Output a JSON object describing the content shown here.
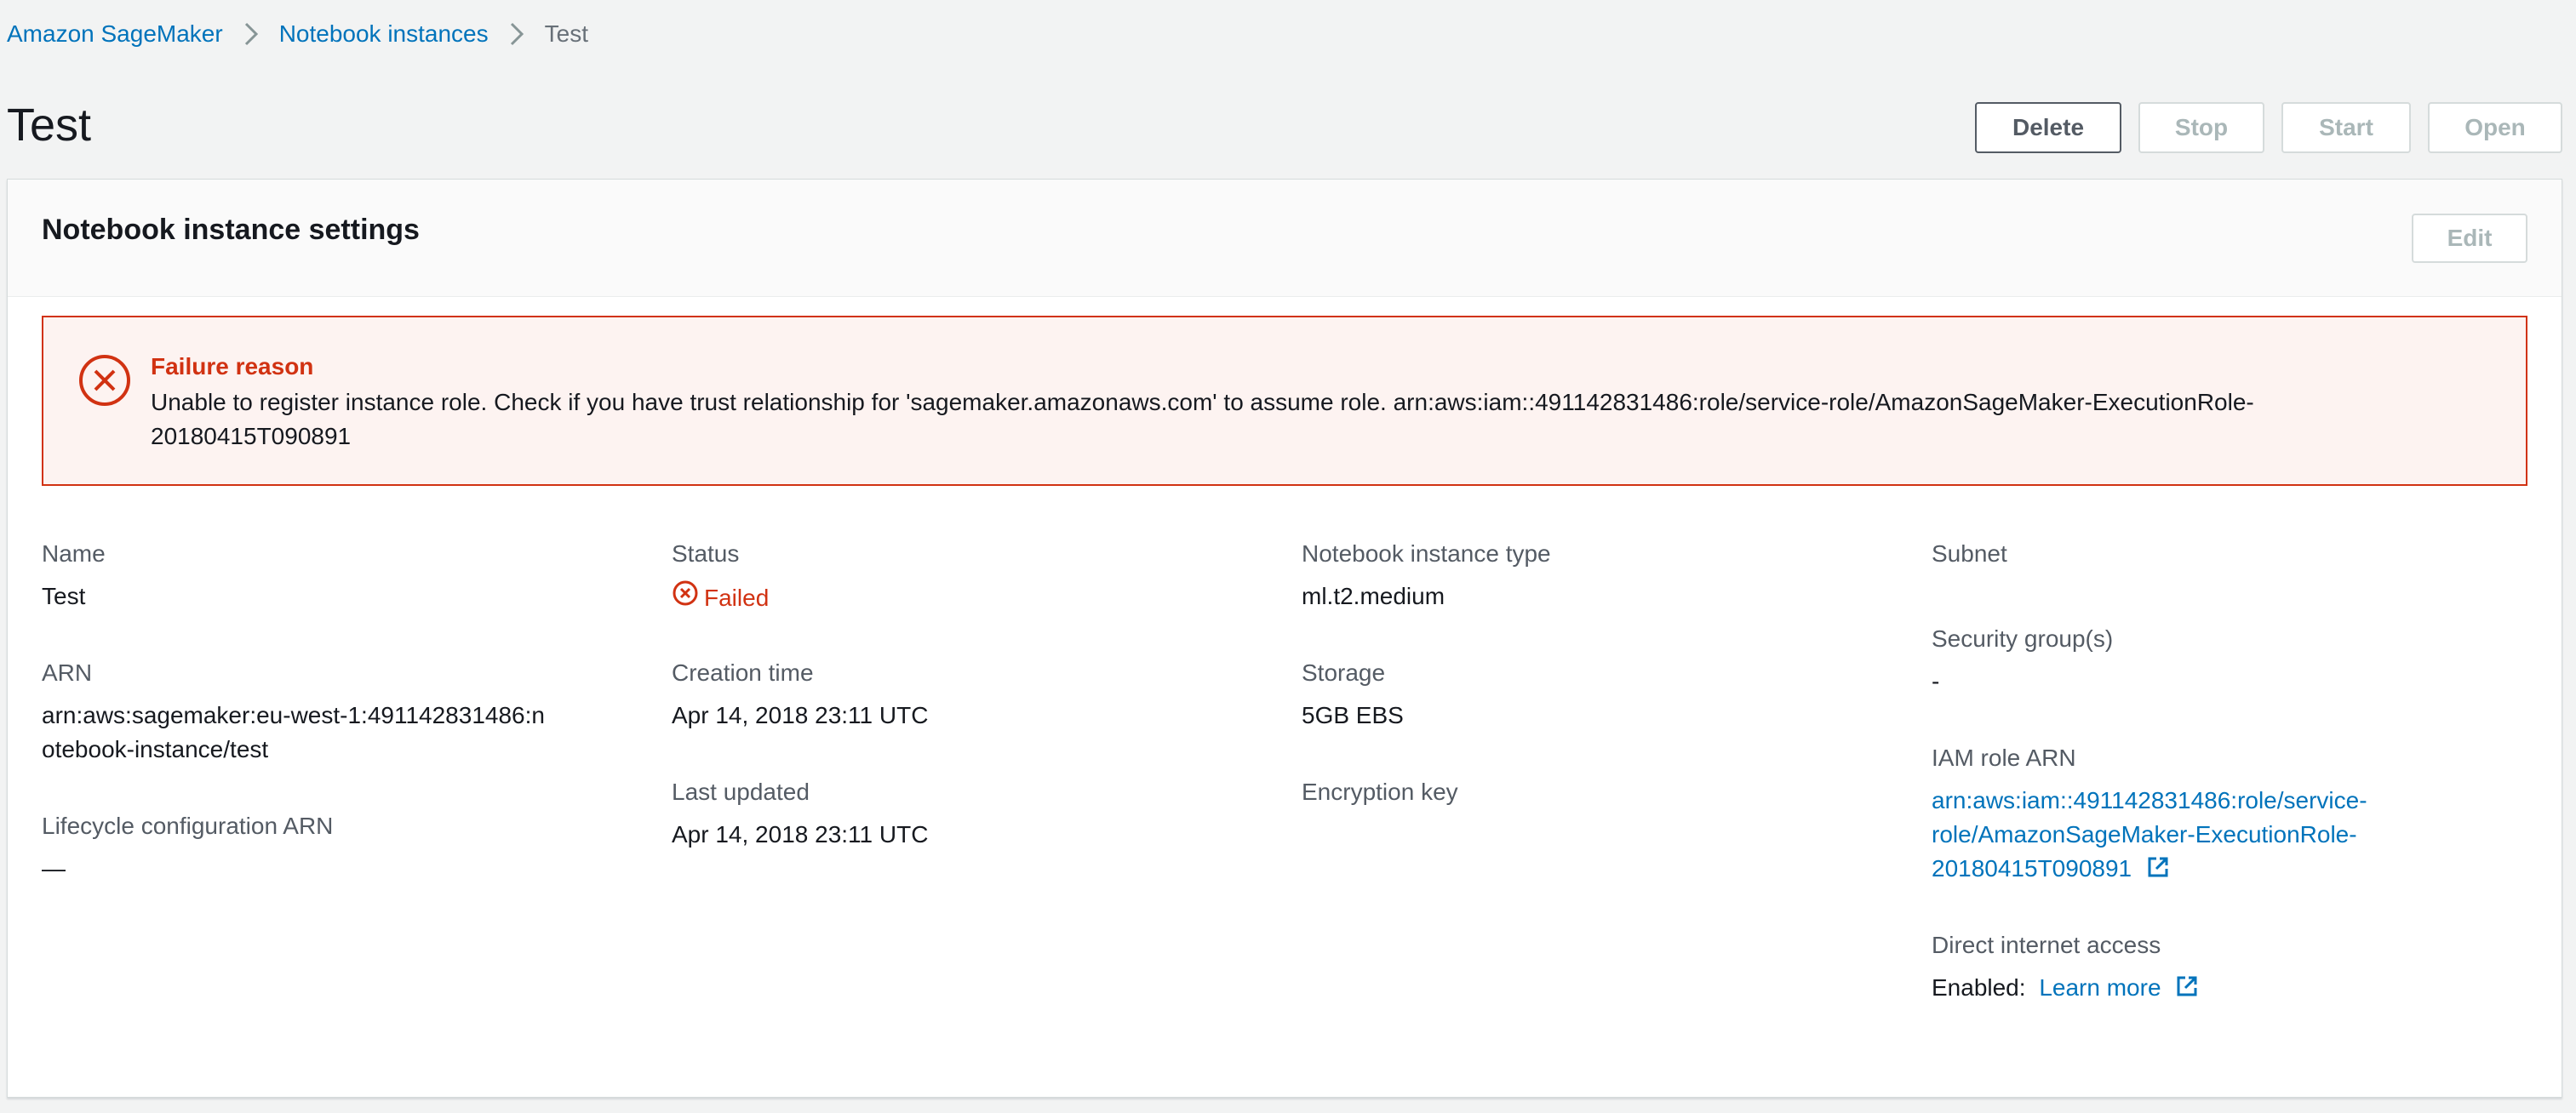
{
  "breadcrumb": {
    "items": [
      "Amazon SageMaker",
      "Notebook instances"
    ],
    "current": "Test"
  },
  "page": {
    "title": "Test"
  },
  "actions": {
    "delete": "Delete",
    "stop": "Stop",
    "start": "Start",
    "open": "Open"
  },
  "settings": {
    "title": "Notebook instance settings",
    "edit": "Edit",
    "alert": {
      "title": "Failure reason",
      "message": "Unable to register instance role. Check if you have trust relationship for 'sagemaker.amazonaws.com' to assume role. arn:aws:iam::491142831486:role/service-role/AmazonSageMaker-ExecutionRole-20180415T090891"
    },
    "fields": {
      "name": {
        "label": "Name",
        "value": "Test"
      },
      "arn": {
        "label": "ARN",
        "value": "arn:aws:sagemaker:eu-west-1:491142831486:notebook-instance/test"
      },
      "lifecycle": {
        "label": "Lifecycle configuration ARN",
        "value": "—"
      },
      "status": {
        "label": "Status",
        "value": "Failed"
      },
      "creation": {
        "label": "Creation time",
        "value": "Apr 14, 2018 23:11 UTC"
      },
      "updated": {
        "label": "Last updated",
        "value": "Apr 14, 2018 23:11 UTC"
      },
      "type": {
        "label": "Notebook instance type",
        "value": "ml.t2.medium"
      },
      "storage": {
        "label": "Storage",
        "value": "5GB EBS"
      },
      "encryption": {
        "label": "Encryption key",
        "value": ""
      },
      "subnet": {
        "label": "Subnet",
        "value": ""
      },
      "security": {
        "label": "Security group(s)",
        "value": "-"
      },
      "iam": {
        "label": "IAM role ARN",
        "value": "arn:aws:iam::491142831486:role/service-role/AmazonSageMaker-ExecutionRole-20180415T090891"
      },
      "internet": {
        "label": "Direct internet access",
        "value": "Enabled:",
        "link": "Learn more"
      }
    }
  },
  "colors": {
    "link": "#0073bb",
    "error": "#d13212",
    "text": "#16191f",
    "label": "#545b64"
  }
}
